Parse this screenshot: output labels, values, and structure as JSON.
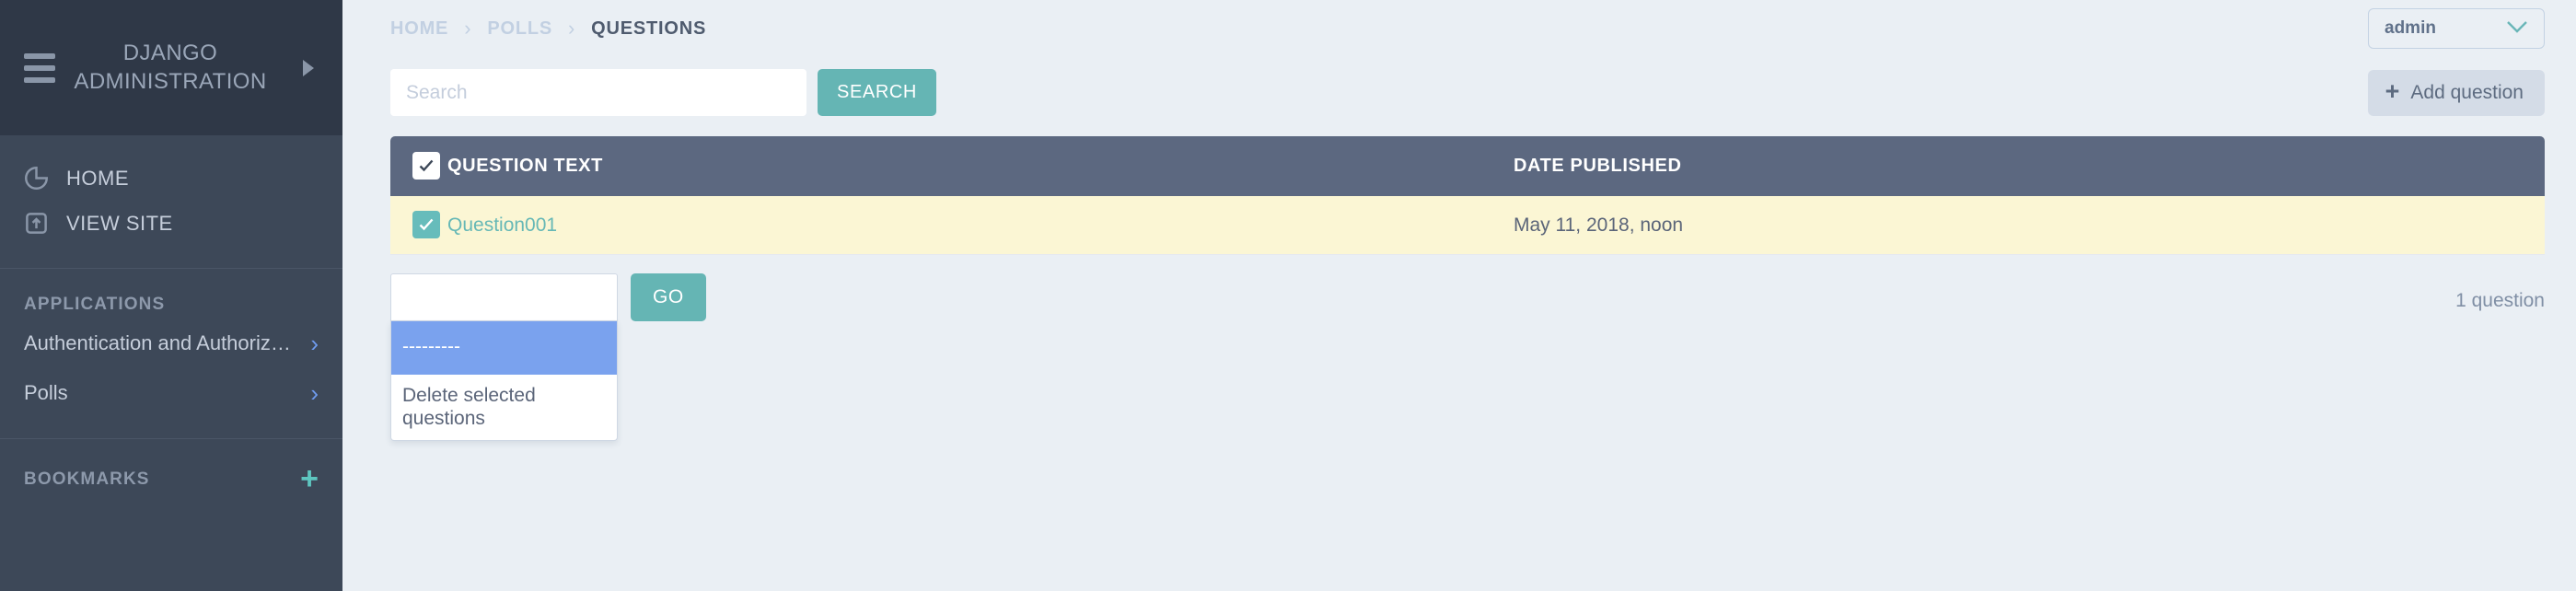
{
  "sidebar": {
    "brand": "DJANGO ADMINISTRATION",
    "hamburger_icon": "hamburger-icon",
    "pin_icon": "pin-icon",
    "nav": [
      {
        "label": "HOME",
        "icon": "dashboard-circle-icon"
      },
      {
        "label": "VIEW SITE",
        "icon": "open-external-icon"
      }
    ],
    "applications_label": "APPLICATIONS",
    "apps": [
      {
        "label": "Authentication and Authoriz…",
        "chevron": "chevron-right-icon"
      },
      {
        "label": "Polls",
        "chevron": "chevron-right-icon"
      }
    ],
    "bookmarks_label": "BOOKMARKS",
    "bookmarks_add_icon": "plus-icon"
  },
  "header": {
    "breadcrumb": [
      {
        "label": "HOME",
        "current": false
      },
      {
        "label": "POLLS",
        "current": false
      },
      {
        "label": "QUESTIONS",
        "current": true
      }
    ],
    "separator": "›",
    "user": {
      "name": "admin",
      "chevron": "chevron-down-icon"
    }
  },
  "toolbar": {
    "search_value": "",
    "search_placeholder": "Search",
    "search_button": "SEARCH",
    "add_button": "Add question",
    "add_icon": "plus-icon"
  },
  "table": {
    "select_all_checkbox": "select-all-checkbox",
    "columns": [
      "QUESTION TEXT",
      "DATE PUBLISHED"
    ],
    "rows": [
      {
        "checked": true,
        "question_text": "Question001",
        "date_published": "May 11, 2018, noon"
      }
    ]
  },
  "actions": {
    "input_value": "",
    "go_button": "GO",
    "options": [
      {
        "label": "---------",
        "selected": true
      },
      {
        "label": "Delete selected questions",
        "selected": false
      }
    ]
  },
  "footer": {
    "count": "1 question"
  },
  "colors": {
    "sidebar_bg": "#3d4858",
    "sidebar_header_bg": "#2f3847",
    "page_bg": "#eaeff4",
    "accent_teal": "#65b5b4",
    "table_header_bg": "#5c6880",
    "row_selected_bg": "#fbf6d4",
    "option_selected_bg": "#7aa2ee",
    "chevron_blue": "#6f9bee"
  }
}
